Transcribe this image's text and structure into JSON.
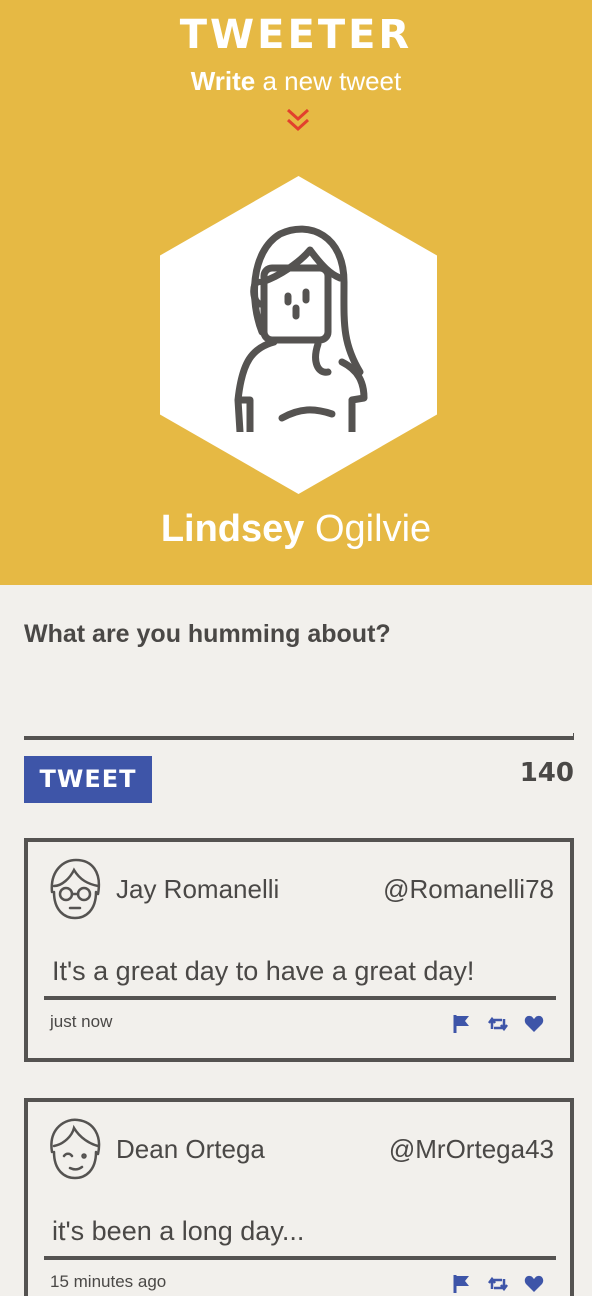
{
  "app": {
    "logo": "TWEETER",
    "subtitle_bold": "Write",
    "subtitle_rest": " a new tweet"
  },
  "profile": {
    "first_name": "Lindsey",
    "last_name": " Ogilvie"
  },
  "compose": {
    "prompt": "What are you humming about?",
    "value": "",
    "button_label": "TWEET",
    "char_count": "140"
  },
  "tweets": [
    {
      "name": "Jay Romanelli",
      "handle": "@Romanelli78",
      "text": "It's a great day to have a great day!",
      "time": "just now"
    },
    {
      "name": "Dean Ortega",
      "handle": "@MrOrtega43",
      "text": "it's been a long day...",
      "time": "15 minutes ago"
    }
  ],
  "icons": {
    "chevron": "double-chevron-down-icon",
    "flag": "flag-icon",
    "retweet": "retweet-icon",
    "like": "heart-icon"
  },
  "colors": {
    "hero_bg": "#e6b944",
    "page_bg": "#f2f0ec",
    "accent_blue": "#3e55a8",
    "chevron_red": "#e2402d",
    "text_dark": "#4a4846"
  }
}
